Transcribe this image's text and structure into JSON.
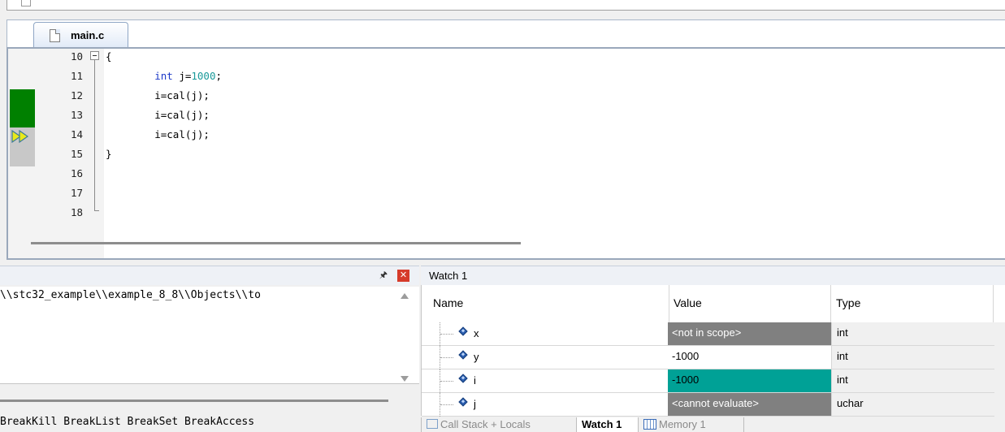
{
  "editor": {
    "tab_label": "main.c",
    "line_numbers": [
      "10",
      "11",
      "12",
      "13",
      "14",
      "15",
      "16",
      "17",
      "18"
    ],
    "code": {
      "l10": "{",
      "l11_kw": "int",
      "l11_mid": " j=",
      "l11_num": "1000",
      "l11_end": ";",
      "l12": "i=cal(j);",
      "l13": "i=cal(j);",
      "l14": "i=cal(j);",
      "l15": "}"
    }
  },
  "command_window": {
    "path_text": "\\\\stc32_example\\\\example_8_8\\\\Objects\\\\to",
    "hints_text": "BreakKill BreakList BreakSet BreakAccess"
  },
  "watch": {
    "title": "Watch 1",
    "columns": {
      "name": "Name",
      "value": "Value",
      "type": "Type"
    },
    "rows": [
      {
        "name": "x",
        "value": "<not in scope>",
        "type": "int",
        "value_bg": "#808080",
        "value_fg": "#ffffff"
      },
      {
        "name": "y",
        "value": "-1000",
        "type": "int",
        "value_bg": "#ffffff",
        "value_fg": "#000000"
      },
      {
        "name": "i",
        "value": "-1000",
        "type": "int",
        "value_bg": "#00a196",
        "value_fg": "#000000"
      },
      {
        "name": "j",
        "value": "<cannot evaluate>",
        "type": "uchar",
        "value_bg": "#808080",
        "value_fg": "#ffffff"
      }
    ],
    "type_bg": "#f0f0f0"
  },
  "bottom_tabs": {
    "callstack": "Call Stack + Locals",
    "watch1": "Watch 1",
    "memory1": "Memory 1"
  },
  "colors": {
    "coverage_executed": "#008000",
    "coverage_pending": "#c8c8c8",
    "keyword": "#1c39c8",
    "number": "#1a9a9a"
  }
}
